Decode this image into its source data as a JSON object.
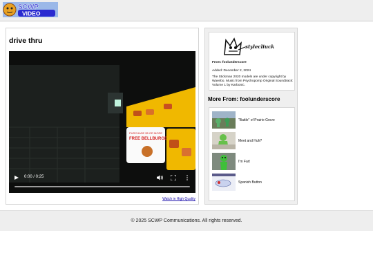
{
  "header": {
    "logo_text": "SCWP VIDEO"
  },
  "video": {
    "title": "drive thru",
    "time": "0:00 / 0:25",
    "progress": 0,
    "hq_link": "Watch in High Quality"
  },
  "sidebar": {
    "channel_logo_text": "stylecliuck",
    "from": "From: foolunderscore",
    "added": "Added: December 2, 2024",
    "description": "The Stickman 2020 models are under copyright by Wavebo. Music from Psychopomp Original Soundtrack: Volume 1 by Karbonic.",
    "more_title": "More From: foolunderscore",
    "related": [
      {
        "title": "\"Battle\" of Prairie Grove"
      },
      {
        "title": "Meet and Huh?"
      },
      {
        "title": "I'm Fart"
      },
      {
        "title": "Spanish Button"
      }
    ]
  },
  "footer": {
    "text": "© 2025 SCWP Communications. All rights reserved."
  },
  "colors": {
    "link": "#1a0dab",
    "logo_blue": "#2a2ad0",
    "menu_yellow": "#f0b800"
  }
}
